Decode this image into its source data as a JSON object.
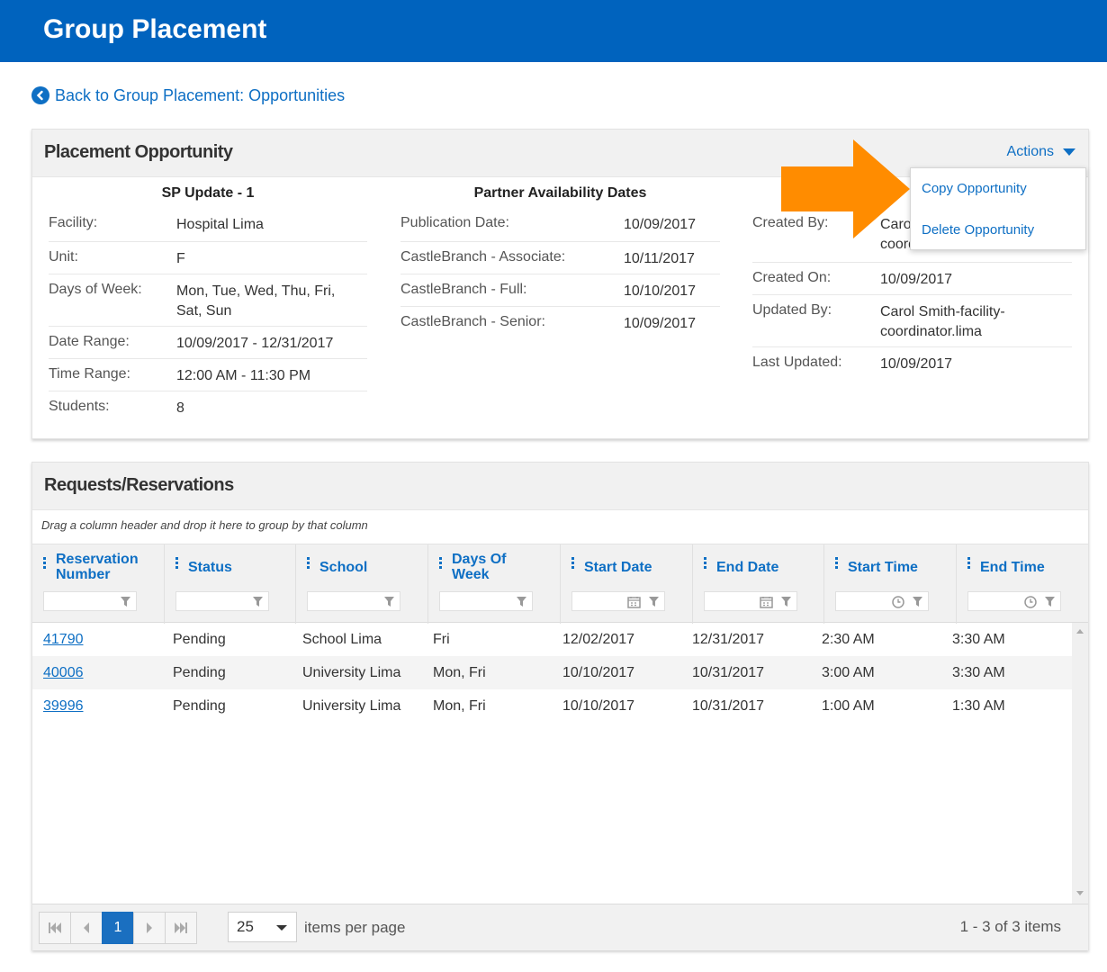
{
  "header": {
    "title": "Group Placement"
  },
  "back_link": {
    "label": "Back to Group Placement: Opportunities"
  },
  "opportunity": {
    "title": "Placement Opportunity",
    "actions_label": "Actions",
    "menu": {
      "copy": "Copy Opportunity",
      "delete": "Delete Opportunity"
    },
    "summary": {
      "heading": "SP Update - 1",
      "rows": [
        {
          "key": "Facility:",
          "value": "Hospital Lima"
        },
        {
          "key": "Unit:",
          "value": "F"
        },
        {
          "key": "Days of Week:",
          "value": "Mon, Tue, Wed, Thu, Fri, Sat, Sun"
        },
        {
          "key": "Date Range:",
          "value": "10/09/2017 - 12/31/2017"
        },
        {
          "key": "Time Range:",
          "value": "12:00 AM - 11:30 PM"
        },
        {
          "key": "Students:",
          "value": "8"
        }
      ]
    },
    "availability": {
      "heading": "Partner Availability Dates",
      "rows": [
        {
          "key": "Publication Date:",
          "value": "10/09/2017"
        },
        {
          "key": "CastleBranch - Associate:",
          "value": "10/11/2017"
        },
        {
          "key": "CastleBranch - Full:",
          "value": "10/10/2017"
        },
        {
          "key": "CastleBranch - Senior:",
          "value": "10/09/2017"
        }
      ]
    },
    "audit": {
      "rows": [
        {
          "key": "Created By:",
          "value": "Carol Smith-facility-coordinator.lima"
        },
        {
          "key": "Created On:",
          "value": "10/09/2017"
        },
        {
          "key": "Updated By:",
          "value": "Carol Smith-facility-coordinator.lima"
        },
        {
          "key": "Last Updated:",
          "value": "10/09/2017"
        }
      ]
    }
  },
  "requests": {
    "title": "Requests/Reservations",
    "group_hint": "Drag a column header and drop it here to group by that column",
    "columns": [
      {
        "label": "Reservation Number",
        "filter": "text"
      },
      {
        "label": "Status",
        "filter": "text"
      },
      {
        "label": "School",
        "filter": "text"
      },
      {
        "label": "Days Of Week",
        "filter": "text"
      },
      {
        "label": "Start Date",
        "filter": "date"
      },
      {
        "label": "End Date",
        "filter": "date"
      },
      {
        "label": "Start Time",
        "filter": "time"
      },
      {
        "label": "End Time",
        "filter": "time"
      }
    ],
    "rows": [
      [
        "41790",
        "Pending",
        "School Lima",
        "Fri",
        "12/02/2017",
        "12/31/2017",
        "2:30 AM",
        "3:30 AM"
      ],
      [
        "40006",
        "Pending",
        "University Lima",
        "Mon, Fri",
        "10/10/2017",
        "10/31/2017",
        "3:00 AM",
        "3:30 AM"
      ],
      [
        "39996",
        "Pending",
        "University Lima",
        "Mon, Fri",
        "10/10/2017",
        "10/31/2017",
        "1:00 AM",
        "1:30 AM"
      ]
    ],
    "pager": {
      "current_page": "1",
      "page_size": "25",
      "items_per_page_label": "items per page",
      "summary": "1 - 3 of 3 items"
    }
  },
  "colors": {
    "brand": "#0063be",
    "link": "#0e6fc4",
    "arrow": "#ff8c00"
  },
  "icons": [
    "chevron-left-icon",
    "caret-down-icon",
    "column-menu-icon",
    "filter-icon",
    "calendar-icon",
    "clock-icon",
    "first-page-icon",
    "prev-page-icon",
    "next-page-icon",
    "last-page-icon"
  ]
}
